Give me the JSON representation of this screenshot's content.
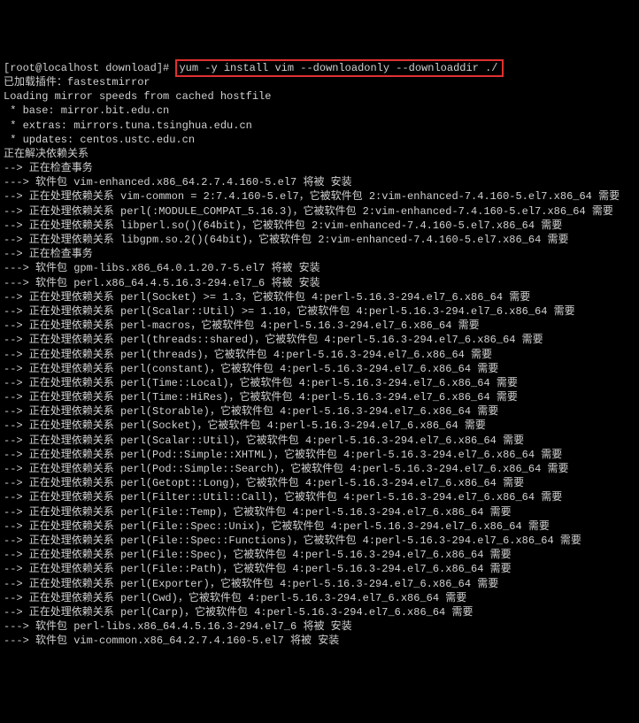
{
  "prompt_prefix": "[root@localhost download]# ",
  "command": "yum -y install vim --downloadonly --downloaddir ./",
  "lines": [
    "已加载插件：fastestmirror",
    "Loading mirror speeds from cached hostfile",
    " * base: mirror.bit.edu.cn",
    " * extras: mirrors.tuna.tsinghua.edu.cn",
    " * updates: centos.ustc.edu.cn",
    "正在解决依赖关系",
    "--> 正在检查事务",
    "---> 软件包 vim-enhanced.x86_64.2.7.4.160-5.el7 将被 安装",
    "--> 正在处理依赖关系 vim-common = 2:7.4.160-5.el7，它被软件包 2:vim-enhanced-7.4.160-5.el7.x86_64 需要",
    "--> 正在处理依赖关系 perl(:MODULE_COMPAT_5.16.3)，它被软件包 2:vim-enhanced-7.4.160-5.el7.x86_64 需要",
    "--> 正在处理依赖关系 libperl.so()(64bit)，它被软件包 2:vim-enhanced-7.4.160-5.el7.x86_64 需要",
    "--> 正在处理依赖关系 libgpm.so.2()(64bit)，它被软件包 2:vim-enhanced-7.4.160-5.el7.x86_64 需要",
    "--> 正在检查事务",
    "---> 软件包 gpm-libs.x86_64.0.1.20.7-5.el7 将被 安装",
    "---> 软件包 perl.x86_64.4.5.16.3-294.el7_6 将被 安装",
    "--> 正在处理依赖关系 perl(Socket) >= 1.3，它被软件包 4:perl-5.16.3-294.el7_6.x86_64 需要",
    "--> 正在处理依赖关系 perl(Scalar::Util) >= 1.10，它被软件包 4:perl-5.16.3-294.el7_6.x86_64 需要",
    "--> 正在处理依赖关系 perl-macros，它被软件包 4:perl-5.16.3-294.el7_6.x86_64 需要",
    "--> 正在处理依赖关系 perl(threads::shared)，它被软件包 4:perl-5.16.3-294.el7_6.x86_64 需要",
    "--> 正在处理依赖关系 perl(threads)，它被软件包 4:perl-5.16.3-294.el7_6.x86_64 需要",
    "--> 正在处理依赖关系 perl(constant)，它被软件包 4:perl-5.16.3-294.el7_6.x86_64 需要",
    "--> 正在处理依赖关系 perl(Time::Local)，它被软件包 4:perl-5.16.3-294.el7_6.x86_64 需要",
    "--> 正在处理依赖关系 perl(Time::HiRes)，它被软件包 4:perl-5.16.3-294.el7_6.x86_64 需要",
    "--> 正在处理依赖关系 perl(Storable)，它被软件包 4:perl-5.16.3-294.el7_6.x86_64 需要",
    "--> 正在处理依赖关系 perl(Socket)，它被软件包 4:perl-5.16.3-294.el7_6.x86_64 需要",
    "--> 正在处理依赖关系 perl(Scalar::Util)，它被软件包 4:perl-5.16.3-294.el7_6.x86_64 需要",
    "--> 正在处理依赖关系 perl(Pod::Simple::XHTML)，它被软件包 4:perl-5.16.3-294.el7_6.x86_64 需要",
    "--> 正在处理依赖关系 perl(Pod::Simple::Search)，它被软件包 4:perl-5.16.3-294.el7_6.x86_64 需要",
    "--> 正在处理依赖关系 perl(Getopt::Long)，它被软件包 4:perl-5.16.3-294.el7_6.x86_64 需要",
    "--> 正在处理依赖关系 perl(Filter::Util::Call)，它被软件包 4:perl-5.16.3-294.el7_6.x86_64 需要",
    "--> 正在处理依赖关系 perl(File::Temp)，它被软件包 4:perl-5.16.3-294.el7_6.x86_64 需要",
    "--> 正在处理依赖关系 perl(File::Spec::Unix)，它被软件包 4:perl-5.16.3-294.el7_6.x86_64 需要",
    "--> 正在处理依赖关系 perl(File::Spec::Functions)，它被软件包 4:perl-5.16.3-294.el7_6.x86_64 需要",
    "--> 正在处理依赖关系 perl(File::Spec)，它被软件包 4:perl-5.16.3-294.el7_6.x86_64 需要",
    "--> 正在处理依赖关系 perl(File::Path)，它被软件包 4:perl-5.16.3-294.el7_6.x86_64 需要",
    "--> 正在处理依赖关系 perl(Exporter)，它被软件包 4:perl-5.16.3-294.el7_6.x86_64 需要",
    "--> 正在处理依赖关系 perl(Cwd)，它被软件包 4:perl-5.16.3-294.el7_6.x86_64 需要",
    "--> 正在处理依赖关系 perl(Carp)，它被软件包 4:perl-5.16.3-294.el7_6.x86_64 需要",
    "---> 软件包 perl-libs.x86_64.4.5.16.3-294.el7_6 将被 安装",
    "---> 软件包 vim-common.x86_64.2.7.4.160-5.el7 将被 安装"
  ]
}
